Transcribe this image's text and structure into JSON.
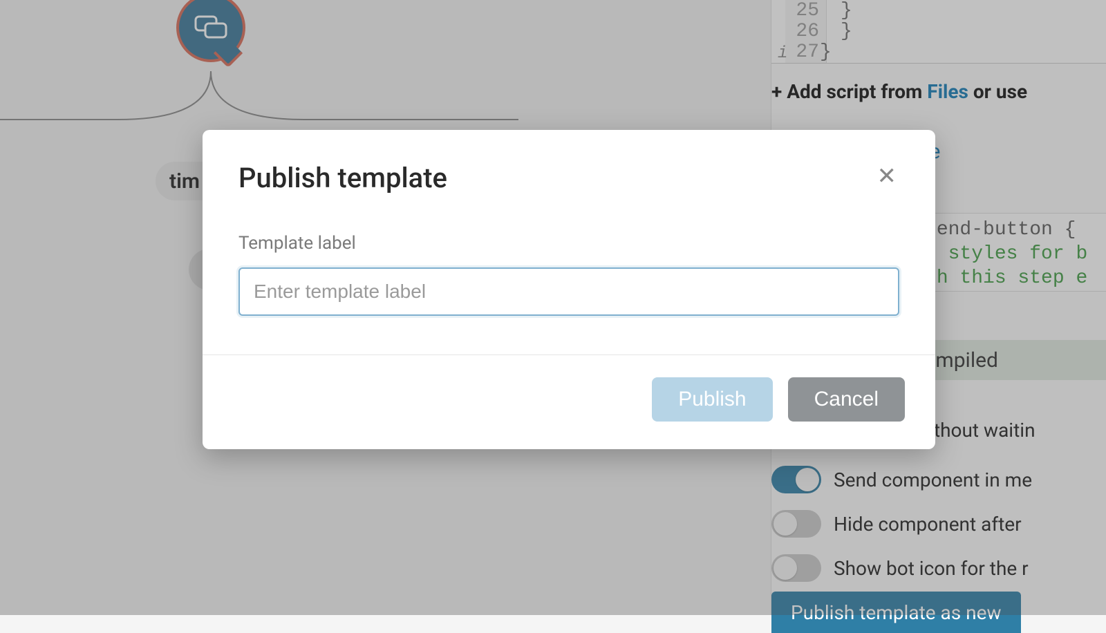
{
  "canvas": {
    "node_pill_text": "tim",
    "chat_icon": "chat-bubbles-icon"
  },
  "right_panel": {
    "code_lines": [
      {
        "num": "25",
        "text": "}"
      },
      {
        "num": "26",
        "text": "}"
      },
      {
        "num": "27",
        "text": "}"
      }
    ],
    "gutter_info_glyph": "i",
    "add_script_prefix": "+ Add script from ",
    "add_script_link": "Files",
    "add_script_suffix": " or use",
    "variable_link": "variable",
    "css_snippet_line1": "stom-send-button {",
    "css_snippet_line2": "/* add styles for b",
    "css_snippet_line3": "/* with this step e",
    "css_compiled_label": "CSS compiled",
    "options": [
      {
        "label": "ceed without waitin",
        "toggle": null
      },
      {
        "label": "Send component in me",
        "toggle": true
      },
      {
        "label": "Hide component after",
        "toggle": false
      },
      {
        "label": "Show bot icon for the r",
        "toggle": false
      }
    ],
    "publish_new_button": "Publish template as new"
  },
  "modal": {
    "title": "Publish template",
    "close_glyph": "✕",
    "field_label": "Template label",
    "input_placeholder": "Enter template label",
    "input_value": "",
    "publish_label": "Publish",
    "cancel_label": "Cancel"
  }
}
